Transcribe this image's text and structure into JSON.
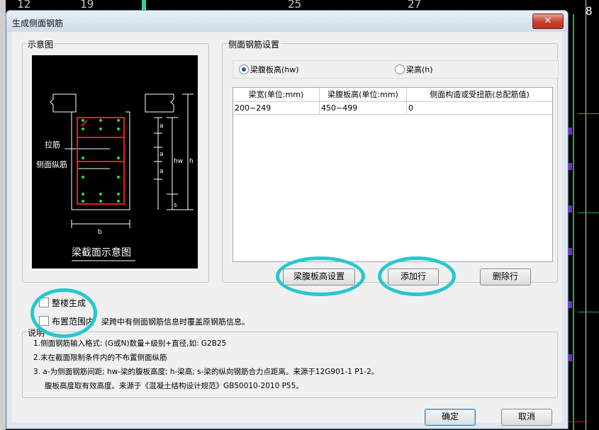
{
  "background_numbers": [
    "12",
    "19",
    "25",
    "27",
    "8"
  ],
  "dialog": {
    "title": "生成侧面钢筋",
    "close_label": "✕"
  },
  "diagram_group": {
    "label": "示意图",
    "labels": {
      "tie_bar": "拉筋",
      "side_bar": "侧面纵筋",
      "a1": "a",
      "a2": "a",
      "a3": "a",
      "s": "s",
      "hw": "hw",
      "h": "h",
      "b": "b",
      "caption": "梁截面示意图"
    }
  },
  "settings_group": {
    "label": "侧面钢筋设置",
    "radio_web_height": "梁腹板高(hw)",
    "radio_beam_height": "梁高(h)",
    "selected": "web_height"
  },
  "table": {
    "headers": [
      "梁宽(单位:mm)",
      "梁腹板高(单位:mm)",
      "侧面构造或受扭筋(总配筋值)"
    ],
    "rows": [
      [
        "200~249",
        "450~499",
        "0"
      ]
    ]
  },
  "buttons": {
    "web_height_setting": "梁腹板高设置",
    "add_row": "添加行",
    "delete_row": "删除行",
    "ok": "确定",
    "cancel": "取消"
  },
  "options": {
    "whole_building": "整楼生成",
    "within_range": "布置范围内",
    "overwrite_note": "梁跨中有侧面钢筋信息时覆盖原钢筋信息。"
  },
  "notes": {
    "label": "说明",
    "line1": "1.侧面钢筋输入格式: (G或N)数量+级别+直径,如: G2B25",
    "line2": "2.末在截面限制条件内的不布置侧面纵筋",
    "line3": "3. a-为侧面钢筋间距; hw-梁的腹板高度; h-梁高; s-梁的纵向钢筋合力点距离。来源于12G901-1 P1-2。",
    "line4": "腹板高度取有效高度。来源于《混凝土结构设计规范》GB50010-2010 P55。"
  },
  "colors": {
    "highlight": "#28c7cf",
    "rebar_red": "#e02020",
    "rebar_green": "#2de02d"
  }
}
